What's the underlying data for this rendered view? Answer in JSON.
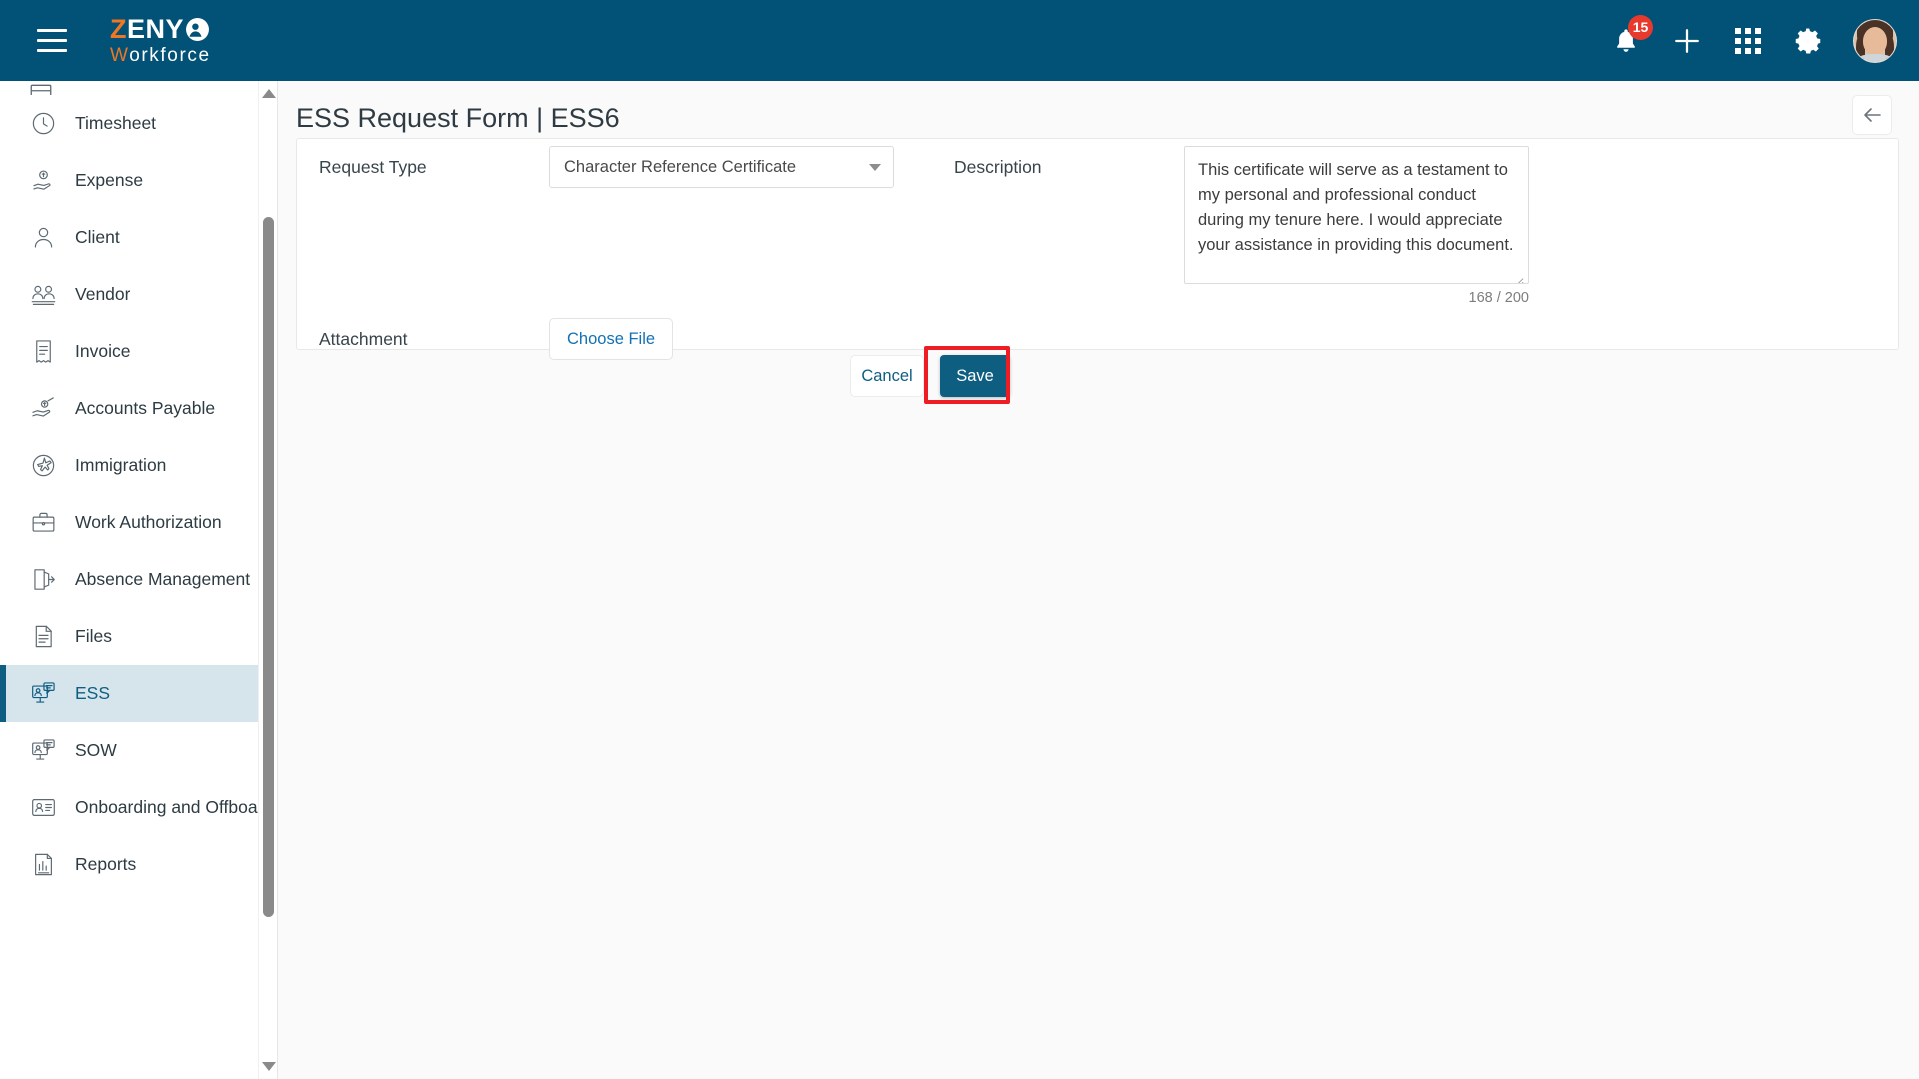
{
  "header": {
    "menu_icon": "hamburger-icon",
    "logo": {
      "part1": "Z",
      "part2": "ENY",
      "part3": "W",
      "part4": "orkforce",
      "mark": "person-circle-icon"
    },
    "notifications": {
      "icon": "bell-icon",
      "badge": "15"
    },
    "add_icon": "plus-icon",
    "apps_icon": "grid-apps-icon",
    "settings_icon": "gear-icon",
    "avatar": "user-avatar"
  },
  "sidebar": {
    "items": [
      {
        "label": "Timesheet",
        "icon": "clock-icon",
        "active": false
      },
      {
        "label": "Expense",
        "icon": "hand-coin-icon",
        "active": false
      },
      {
        "label": "Client",
        "icon": "person-icon",
        "active": false
      },
      {
        "label": "Vendor",
        "icon": "people-group-icon",
        "active": false
      },
      {
        "label": "Invoice",
        "icon": "receipt-icon",
        "active": false
      },
      {
        "label": "Accounts Payable",
        "icon": "hand-money-icon",
        "active": false
      },
      {
        "label": "Immigration",
        "icon": "airplane-globe-icon",
        "active": false
      },
      {
        "label": "Work Authorization",
        "icon": "briefcase-icon",
        "active": false
      },
      {
        "label": "Absence Management",
        "icon": "door-exit-icon",
        "active": false
      },
      {
        "label": "Files",
        "icon": "document-icon",
        "active": false
      },
      {
        "label": "ESS",
        "icon": "monitor-chat-icon",
        "active": true
      },
      {
        "label": "SOW",
        "icon": "monitor-chat-icon",
        "active": false
      },
      {
        "label": "Onboarding and Offboa...",
        "icon": "id-card-icon",
        "active": false
      },
      {
        "label": "Reports",
        "icon": "report-chart-icon",
        "active": false
      }
    ],
    "scrollbar": {
      "up_icon": "scroll-up-arrow",
      "down_icon": "scroll-down-arrow"
    }
  },
  "main": {
    "title": "ESS Request Form | ESS6",
    "back_icon": "arrow-left-icon",
    "form": {
      "request_type": {
        "label": "Request Type",
        "value": "Character Reference Certificate",
        "caret_icon": "chevron-down-icon"
      },
      "description": {
        "label": "Description",
        "value": "This certificate will serve as a testament to my personal and professional conduct during my tenure here. I would appreciate your assistance in providing this document.",
        "counter": "168 / 200",
        "resize_icon": "resize-grip-icon"
      },
      "attachment": {
        "label": "Attachment",
        "button_label": "Choose File"
      },
      "cancel_label": "Cancel",
      "save_label": "Save"
    }
  },
  "colors": {
    "header_bg": "#015276",
    "accent": "#0e5e82",
    "logo_orange": "#ef7622",
    "badge_red": "#e8392d",
    "highlight_red": "#ee1c25",
    "active_nav_bg": "#d6e4ec",
    "page_bg": "#fafafa",
    "link_blue": "#1272b5"
  }
}
